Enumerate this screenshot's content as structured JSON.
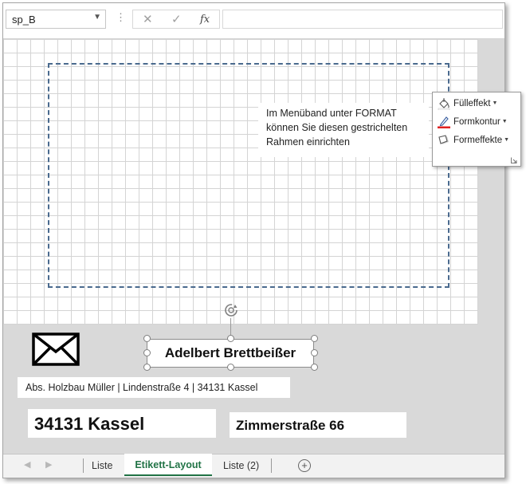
{
  "formula_bar": {
    "name_box_value": "sp_B",
    "fx_label": "fx"
  },
  "sheet": {
    "note_lines": [
      "Im Menüband unter FORMAT",
      "können Sie diesen gestrichelten",
      "Rahmen einrichten"
    ],
    "name_box_text": "Adelbert Brettbeißer",
    "sender_line": "Abs. Holzbau Müller | Lindenstraße 4 | 34131 Kassel",
    "city_text": "34131 Kassel",
    "street_text": "Zimmerstraße 66"
  },
  "format_menu": {
    "items": [
      {
        "label": "Fülleffekt",
        "icon": "paint-bucket-icon"
      },
      {
        "label": "Formkontur",
        "icon": "pen-icon"
      },
      {
        "label": "Formeffekte",
        "icon": "shape-effects-icon"
      }
    ]
  },
  "tabs": [
    {
      "label": "Liste",
      "active": false
    },
    {
      "label": "Etikett-Layout",
      "active": true
    },
    {
      "label": "Liste (2)",
      "active": false
    }
  ],
  "colors": {
    "accent": "#217346",
    "dashed_border": "#4a6a8e",
    "outline_red": "#e02020"
  }
}
